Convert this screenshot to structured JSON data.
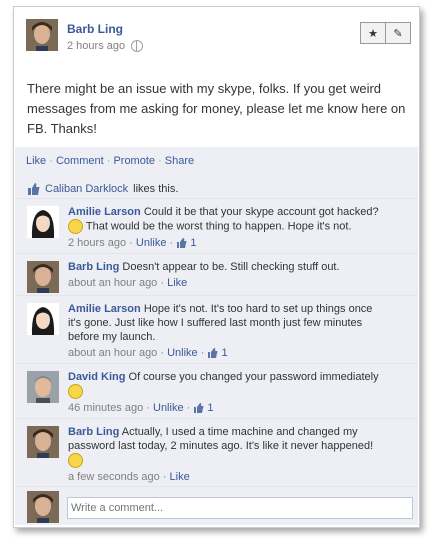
{
  "post": {
    "author": "Barb Ling",
    "time": "2 hours ago",
    "text": "There might be an issue with my skype, folks. If you get weird messages from me asking for money, please let me know here on FB. Thanks!",
    "actions": [
      "Like",
      "Comment",
      "Promote",
      "Share"
    ]
  },
  "likes": {
    "who": "Caliban Darklock",
    "text": "likes this."
  },
  "comments": [
    {
      "author": "Amilie Larson",
      "text": "Could it be that your skype account got hacked?",
      "text2": "That would be the worst thing to happen. Hope it's not.",
      "time": "2 hours ago",
      "action": "Unlike",
      "likes": "1"
    },
    {
      "author": "Barb Ling",
      "text": "Doesn't appear to be. Still checking stuff out.",
      "time": "about an hour ago",
      "action": "Like"
    },
    {
      "author": "Amilie Larson",
      "text": "Hope it's not. It's too hard to set up things once it's gone. Just like how I suffered last month just few minutes before my launch.",
      "time": "about an hour ago",
      "action": "Unlike",
      "likes": "1"
    },
    {
      "author": "David King",
      "text": "Of course you changed your password immediately",
      "time": "46 minutes ago",
      "action": "Unlike",
      "likes": "1"
    },
    {
      "author": "Barb Ling",
      "text": "Actually, I used a time machine and changed my password last today, 2 minutes ago. It's like it never happened!",
      "time": "a few seconds ago",
      "action": "Like"
    }
  ],
  "composer": {
    "placeholder": "Write a comment..."
  },
  "colors": {
    "link": "#3b5998",
    "panel": "#edeff4"
  }
}
